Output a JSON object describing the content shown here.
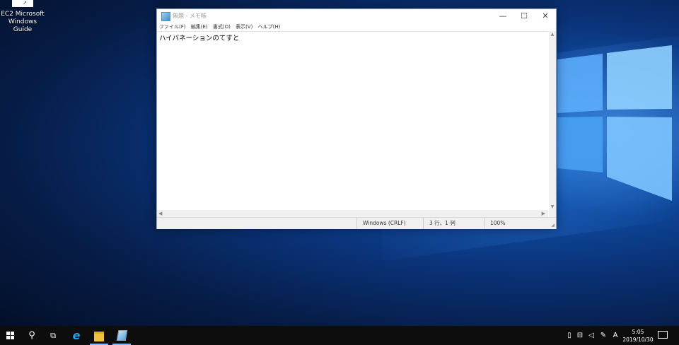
{
  "desktop": {
    "icon_label_line1": "EC2 Microsoft",
    "icon_label_line2": "Windows Guide"
  },
  "notepad": {
    "title": "無題 - メモ帳",
    "menu": [
      "ファイル(F)",
      "編集(E)",
      "書式(O)",
      "表示(V)",
      "ヘルプ(H)"
    ],
    "content": "ハイバネーションのてすと",
    "status": {
      "line_ending": "Windows (CRLF)",
      "position": "3 行、1 列",
      "zoom": "100%"
    },
    "controls": {
      "minimize": "—",
      "maximize": "☐",
      "close": "✕"
    }
  },
  "taskbar": {
    "ime": "A",
    "time": "5:05",
    "date": "2019/10/30"
  }
}
